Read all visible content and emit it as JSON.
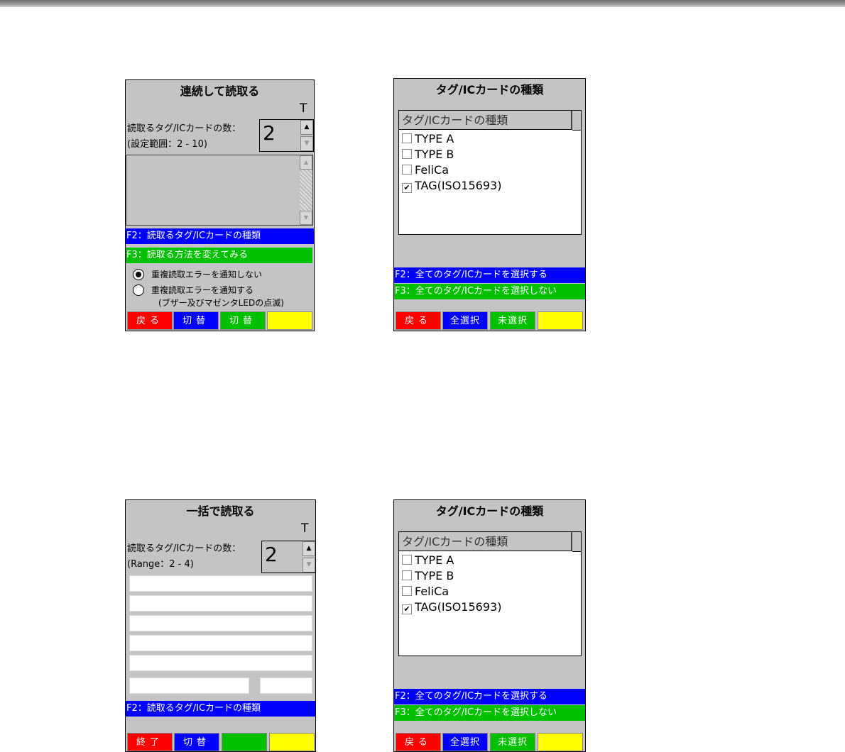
{
  "screen1": {
    "title": "連続して読取る",
    "t": "T",
    "label1": "読取るタグ/ICカードの数：",
    "label2": "(設定範囲：2 - 10)",
    "count": "2",
    "f2": "F2：読取るタグ/ICカードの種類",
    "f3": "F3：読取る方法を変えてみる",
    "radio1": "重複読取エラーを通知しない",
    "radio2": "重複読取エラーを通知する",
    "radio2_note": "(ブザー及びマゼンタLEDの点滅)",
    "radio_selected": 1,
    "buttons": [
      "戻る",
      "切替",
      "切替",
      ""
    ]
  },
  "screen2": {
    "title": "タグ/ICカードの種類",
    "list_header": "タグ/ICカードの種類",
    "items": [
      {
        "label": "TYPE A",
        "checked": false
      },
      {
        "label": "TYPE B",
        "checked": false
      },
      {
        "label": "FeliCa",
        "checked": false
      },
      {
        "label": "TAG(ISO15693)",
        "checked": true
      }
    ],
    "f2": "F2：全てのタグ/ICカードを選択する",
    "f3": "F3：全てのタグ/ICカードを選択しない",
    "buttons": [
      "戻る",
      "全選択",
      "未選択",
      ""
    ]
  },
  "screen3": {
    "title": "一括で読取る",
    "t": "T",
    "label1": "読取るタグ/ICカードの数：",
    "label2": "(Range：2 - 4)",
    "count": "2",
    "f2": "F2：読取るタグ/ICカードの種類",
    "buttons": [
      "終了",
      "切替",
      "",
      ""
    ]
  },
  "screen4": {
    "title": "タグ/ICカードの種類",
    "list_header": "タグ/ICカードの種類",
    "items": [
      {
        "label": "TYPE A",
        "checked": false
      },
      {
        "label": "TYPE B",
        "checked": false
      },
      {
        "label": "FeliCa",
        "checked": false
      },
      {
        "label": "TAG(ISO15693)",
        "checked": true
      }
    ],
    "f2": "F2：全てのタグ/ICカードを選択する",
    "f3": "F3：全てのタグ/ICカードを選択しない",
    "buttons": [
      "戻る",
      "全選択",
      "未選択",
      ""
    ]
  },
  "colors": {
    "blue": "#0000ff",
    "green": "#00c000",
    "red": "#ff0000",
    "yellow": "#ffff00",
    "panel": "#c6c3c6"
  }
}
